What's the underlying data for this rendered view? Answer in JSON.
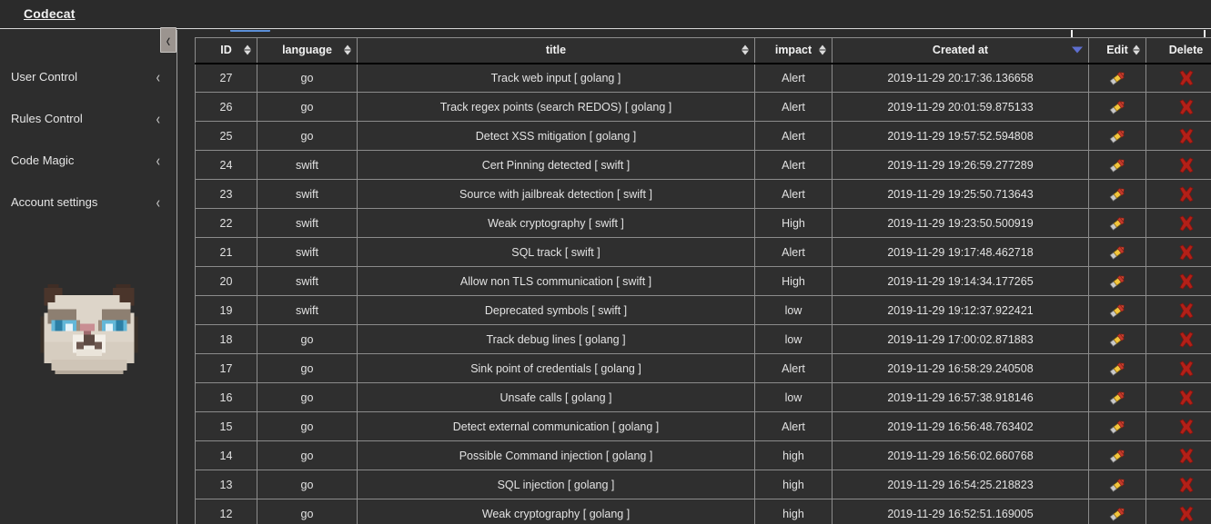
{
  "app": {
    "brand": "Codecat",
    "bg_color": "#2b2b2b",
    "accent_color": "#5b8fd8",
    "sorted_column_color": "#9a5504"
  },
  "sidebar": {
    "items": [
      {
        "label": "User Control",
        "chevron": "chevron-left"
      },
      {
        "label": "Rules Control",
        "chevron": "chevron-left"
      },
      {
        "label": "Code Magic",
        "chevron": "chevron-left"
      },
      {
        "label": "Account settings",
        "chevron": "chevron-left"
      }
    ],
    "collapse_toggle": {
      "icon": "chevron-left-icon",
      "label": "‹"
    },
    "avatar": {
      "name": "grumpy-cat-avatar"
    }
  },
  "main": {
    "search": {
      "value": "",
      "placeholder": ""
    },
    "active_tab_indicator": true
  },
  "table": {
    "columns": [
      {
        "key": "id",
        "label": "ID",
        "sortable": true,
        "sorted": null
      },
      {
        "key": "language",
        "label": "language",
        "sortable": true,
        "sorted": null
      },
      {
        "key": "title",
        "label": "title",
        "sortable": true,
        "sorted": null
      },
      {
        "key": "impact",
        "label": "impact",
        "sortable": true,
        "sorted": null
      },
      {
        "key": "created",
        "label": "Created at",
        "sortable": true,
        "sorted": "desc"
      },
      {
        "key": "edit",
        "label": "Edit",
        "sortable": true,
        "sorted": null
      },
      {
        "key": "delete",
        "label": "Delete",
        "sortable": true,
        "sorted": null
      }
    ],
    "rows": [
      {
        "id": "27",
        "language": "go",
        "title": "Track web input [ golang ]",
        "impact": "Alert",
        "created": "2019-11-29 20:17:36.136658",
        "edit": "edit-icon",
        "delete": "delete-icon"
      },
      {
        "id": "26",
        "language": "go",
        "title": "Track regex points (search REDOS) [ golang ]",
        "impact": "Alert",
        "created": "2019-11-29 20:01:59.875133",
        "edit": "edit-icon",
        "delete": "delete-icon"
      },
      {
        "id": "25",
        "language": "go",
        "title": "Detect XSS mitigation [ golang ]",
        "impact": "Alert",
        "created": "2019-11-29 19:57:52.594808",
        "edit": "edit-icon",
        "delete": "delete-icon"
      },
      {
        "id": "24",
        "language": "swift",
        "title": "Cert Pinning detected [ swift ]",
        "impact": "Alert",
        "created": "2019-11-29 19:26:59.277289",
        "edit": "edit-icon",
        "delete": "delete-icon"
      },
      {
        "id": "23",
        "language": "swift",
        "title": "Source with jailbreak detection [ swift ]",
        "impact": "Alert",
        "created": "2019-11-29 19:25:50.713643",
        "edit": "edit-icon",
        "delete": "delete-icon"
      },
      {
        "id": "22",
        "language": "swift",
        "title": "Weak cryptography [ swift ]",
        "impact": "High",
        "created": "2019-11-29 19:23:50.500919",
        "edit": "edit-icon",
        "delete": "delete-icon"
      },
      {
        "id": "21",
        "language": "swift",
        "title": "SQL track [ swift ]",
        "impact": "Alert",
        "created": "2019-11-29 19:17:48.462718",
        "edit": "edit-icon",
        "delete": "delete-icon"
      },
      {
        "id": "20",
        "language": "swift",
        "title": "Allow non TLS communication [ swift ]",
        "impact": "High",
        "created": "2019-11-29 19:14:34.177265",
        "edit": "edit-icon",
        "delete": "delete-icon"
      },
      {
        "id": "19",
        "language": "swift",
        "title": "Deprecated symbols [ swift ]",
        "impact": "low",
        "created": "2019-11-29 19:12:37.922421",
        "edit": "edit-icon",
        "delete": "delete-icon"
      },
      {
        "id": "18",
        "language": "go",
        "title": "Track debug lines [ golang ]",
        "impact": "low",
        "created": "2019-11-29 17:00:02.871883",
        "edit": "edit-icon",
        "delete": "delete-icon"
      },
      {
        "id": "17",
        "language": "go",
        "title": "Sink point of credentials [ golang ]",
        "impact": "Alert",
        "created": "2019-11-29 16:58:29.240508",
        "edit": "edit-icon",
        "delete": "delete-icon"
      },
      {
        "id": "16",
        "language": "go",
        "title": "Unsafe calls [ golang ]",
        "impact": "low",
        "created": "2019-11-29 16:57:38.918146",
        "edit": "edit-icon",
        "delete": "delete-icon"
      },
      {
        "id": "15",
        "language": "go",
        "title": "Detect external communication [ golang ]",
        "impact": "Alert",
        "created": "2019-11-29 16:56:48.763402",
        "edit": "edit-icon",
        "delete": "delete-icon"
      },
      {
        "id": "14",
        "language": "go",
        "title": "Possible Command injection [ golang ]",
        "impact": "high",
        "created": "2019-11-29 16:56:02.660768",
        "edit": "edit-icon",
        "delete": "delete-icon"
      },
      {
        "id": "13",
        "language": "go",
        "title": "SQL injection [ golang ]",
        "impact": "high",
        "created": "2019-11-29 16:54:25.218823",
        "edit": "edit-icon",
        "delete": "delete-icon"
      },
      {
        "id": "12",
        "language": "go",
        "title": "Weak cryptography [ golang ]",
        "impact": "high",
        "created": "2019-11-29 16:52:51.169005",
        "edit": "edit-icon",
        "delete": "delete-icon"
      }
    ]
  }
}
